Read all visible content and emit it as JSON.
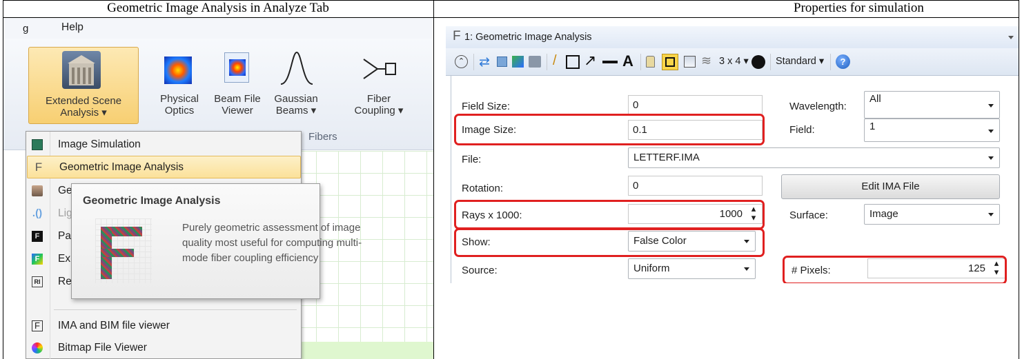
{
  "captions": {
    "left": "Geometric Image Analysis in Analyze Tab",
    "right": "Properties for simulation"
  },
  "left_panel": {
    "menu_bar": {
      "partial": "g",
      "help": "Help"
    },
    "ribbon": {
      "extended_scene": "Extended Scene",
      "extended_scene_2": "Analysis ▾",
      "physical_optics": "Physical",
      "physical_optics_2": "Optics",
      "beam_file": "Beam File",
      "beam_file_2": "Viewer",
      "gaussian": "Gaussian",
      "gaussian_2": "Beams ▾",
      "fiber": "Fiber",
      "fiber_2": "Coupling ▾",
      "group_fibers": "Fibers"
    },
    "menu": {
      "image_simulation": "Image Simulation",
      "geometric_image_analysis": "Geometric Image Analysis",
      "partial_ge": "Ge",
      "partial_li": "Lig",
      "partial_pa": "Pa",
      "partial_ex": "Ex",
      "partial_re": "Re",
      "ima_bim_viewer": "IMA and BIM file viewer",
      "bitmap_viewer": "Bitmap File Viewer"
    },
    "tooltip": {
      "title": "Geometric Image Analysis",
      "line1": "Purely geometric assessment of image",
      "line2": "quality most useful for computing multi-",
      "line3": "mode fiber coupling efficiency"
    }
  },
  "right_panel": {
    "window_title": "1: Geometric Image Analysis",
    "toolbar": {
      "layout": "3 x 4 ▾",
      "standard": "Standard ▾"
    },
    "fields": {
      "field_size_label": "Field Size:",
      "field_size_value": "0",
      "image_size_label": "Image Size:",
      "image_size_value": "0.1",
      "file_label": "File:",
      "file_value": "LETTERF.IMA",
      "rotation_label": "Rotation:",
      "rotation_value": "0",
      "rays_label": "Rays x 1000:",
      "rays_value": "1000",
      "show_label": "Show:",
      "show_value": "False Color",
      "source_label": "Source:",
      "source_value": "Uniform",
      "wavelength_label": "Wavelength:",
      "wavelength_value": "All",
      "field_label": "Field:",
      "field_value": "1",
      "edit_ima_button": "Edit IMA File",
      "surface_label": "Surface:",
      "surface_value": "Image",
      "pixels_label": "# Pixels:",
      "pixels_value": "125"
    }
  },
  "colors": {
    "highlight": "#e02020",
    "menu_selected": "#fde9b4",
    "accent_blue": "#1f5fbf"
  }
}
